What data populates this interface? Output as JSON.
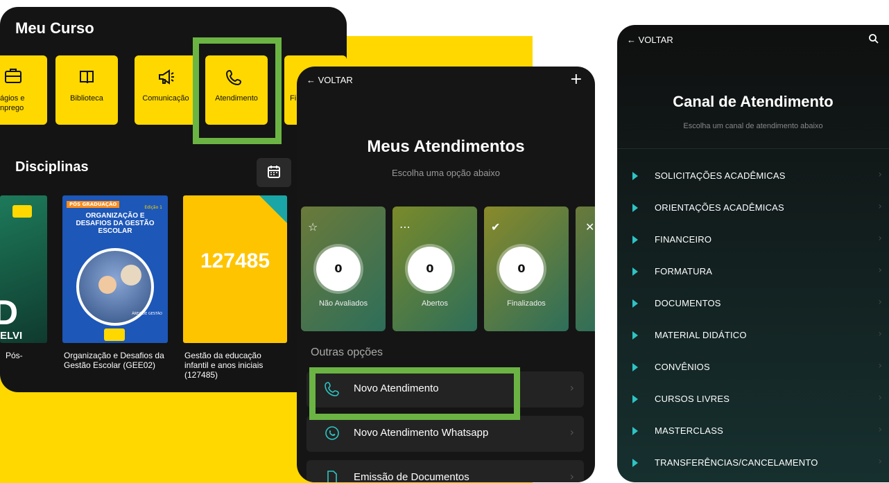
{
  "screen1": {
    "title": "Meu Curso",
    "tiles": [
      {
        "label": "ágios e\nnprego",
        "icon": "briefcase-icon"
      },
      {
        "label": "Biblioteca",
        "icon": "book-icon"
      },
      {
        "label": "Comunicação",
        "icon": "megaphone-icon"
      },
      {
        "label": "Atendimento",
        "icon": "phone-icon"
      },
      {
        "label": "Fi",
        "icon": ""
      }
    ],
    "section_title": "Disciplinas",
    "cards": [
      {
        "cover_big": "D",
        "cover_small": "ELVI",
        "caption": "Pós-"
      },
      {
        "badge": "PÓS GRADUAÇÃO",
        "edition": "Edição 1",
        "cover_title": "ORGANIZAÇÃO E DESAFIOS DA GESTÃO ESCOLAR",
        "area": "ÁREA DE GESTÃO",
        "caption": "Organização e Desafios da Gestão Escolar (GEE02)"
      },
      {
        "code": "127485",
        "caption": "Gestão da educação infantil e anos iniciais (127485)"
      }
    ]
  },
  "screen2": {
    "back_label": "VOLTAR",
    "title": "Meus Atendimentos",
    "subtitle": "Escolha uma opção abaixo",
    "stats": [
      {
        "label": "Não Avaliados",
        "value": "0",
        "icon": "star-icon"
      },
      {
        "label": "Abertos",
        "value": "0",
        "icon": "loading-icon"
      },
      {
        "label": "Finalizados",
        "value": "0",
        "icon": "check-icon"
      }
    ],
    "other_title": "Outras opções",
    "options": [
      {
        "label": "Novo Atendimento",
        "icon": "phone-icon"
      },
      {
        "label": "Novo Atendimento Whatsapp",
        "icon": "whatsapp-icon"
      },
      {
        "label": "Emissão de Documentos",
        "icon": "document-icon"
      }
    ]
  },
  "screen3": {
    "back_label": "VOLTAR",
    "title": "Canal de Atendimento",
    "subtitle": "Escolha um canal de atendimento abaixo",
    "items": [
      "SOLICITAÇÕES ACADÊMICAS",
      "ORIENTAÇÕES ACADÊMICAS",
      "FINANCEIRO",
      "FORMATURA",
      "DOCUMENTOS",
      "MATERIAL DIDÁTICO",
      "CONVÊNIOS",
      "CURSOS LIVRES",
      "MASTERCLASS",
      "TRANSFERÊNCIAS/CANCELAMENTO"
    ]
  },
  "colors": {
    "accent_yellow": "#FFD800",
    "highlight_green": "#6BB444",
    "teal": "#2EC4C4"
  }
}
